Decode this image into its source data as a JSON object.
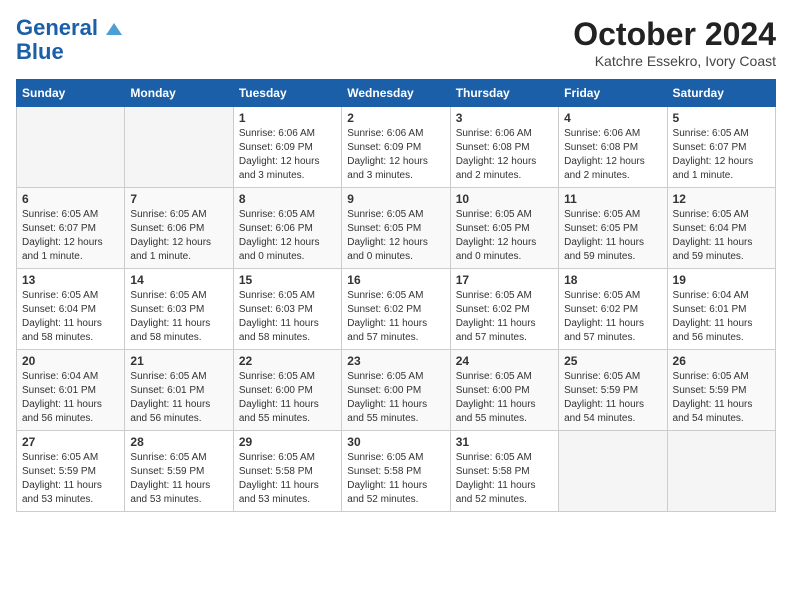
{
  "logo": {
    "line1": "General",
    "line2": "Blue"
  },
  "title": "October 2024",
  "subtitle": "Katchre Essekro, Ivory Coast",
  "weekdays": [
    "Sunday",
    "Monday",
    "Tuesday",
    "Wednesday",
    "Thursday",
    "Friday",
    "Saturday"
  ],
  "weeks": [
    [
      {
        "day": "",
        "info": ""
      },
      {
        "day": "",
        "info": ""
      },
      {
        "day": "1",
        "info": "Sunrise: 6:06 AM\nSunset: 6:09 PM\nDaylight: 12 hours\nand 3 minutes."
      },
      {
        "day": "2",
        "info": "Sunrise: 6:06 AM\nSunset: 6:09 PM\nDaylight: 12 hours\nand 3 minutes."
      },
      {
        "day": "3",
        "info": "Sunrise: 6:06 AM\nSunset: 6:08 PM\nDaylight: 12 hours\nand 2 minutes."
      },
      {
        "day": "4",
        "info": "Sunrise: 6:06 AM\nSunset: 6:08 PM\nDaylight: 12 hours\nand 2 minutes."
      },
      {
        "day": "5",
        "info": "Sunrise: 6:05 AM\nSunset: 6:07 PM\nDaylight: 12 hours\nand 1 minute."
      }
    ],
    [
      {
        "day": "6",
        "info": "Sunrise: 6:05 AM\nSunset: 6:07 PM\nDaylight: 12 hours\nand 1 minute."
      },
      {
        "day": "7",
        "info": "Sunrise: 6:05 AM\nSunset: 6:06 PM\nDaylight: 12 hours\nand 1 minute."
      },
      {
        "day": "8",
        "info": "Sunrise: 6:05 AM\nSunset: 6:06 PM\nDaylight: 12 hours\nand 0 minutes."
      },
      {
        "day": "9",
        "info": "Sunrise: 6:05 AM\nSunset: 6:05 PM\nDaylight: 12 hours\nand 0 minutes."
      },
      {
        "day": "10",
        "info": "Sunrise: 6:05 AM\nSunset: 6:05 PM\nDaylight: 12 hours\nand 0 minutes."
      },
      {
        "day": "11",
        "info": "Sunrise: 6:05 AM\nSunset: 6:05 PM\nDaylight: 11 hours\nand 59 minutes."
      },
      {
        "day": "12",
        "info": "Sunrise: 6:05 AM\nSunset: 6:04 PM\nDaylight: 11 hours\nand 59 minutes."
      }
    ],
    [
      {
        "day": "13",
        "info": "Sunrise: 6:05 AM\nSunset: 6:04 PM\nDaylight: 11 hours\nand 58 minutes."
      },
      {
        "day": "14",
        "info": "Sunrise: 6:05 AM\nSunset: 6:03 PM\nDaylight: 11 hours\nand 58 minutes."
      },
      {
        "day": "15",
        "info": "Sunrise: 6:05 AM\nSunset: 6:03 PM\nDaylight: 11 hours\nand 58 minutes."
      },
      {
        "day": "16",
        "info": "Sunrise: 6:05 AM\nSunset: 6:02 PM\nDaylight: 11 hours\nand 57 minutes."
      },
      {
        "day": "17",
        "info": "Sunrise: 6:05 AM\nSunset: 6:02 PM\nDaylight: 11 hours\nand 57 minutes."
      },
      {
        "day": "18",
        "info": "Sunrise: 6:05 AM\nSunset: 6:02 PM\nDaylight: 11 hours\nand 57 minutes."
      },
      {
        "day": "19",
        "info": "Sunrise: 6:04 AM\nSunset: 6:01 PM\nDaylight: 11 hours\nand 56 minutes."
      }
    ],
    [
      {
        "day": "20",
        "info": "Sunrise: 6:04 AM\nSunset: 6:01 PM\nDaylight: 11 hours\nand 56 minutes."
      },
      {
        "day": "21",
        "info": "Sunrise: 6:05 AM\nSunset: 6:01 PM\nDaylight: 11 hours\nand 56 minutes."
      },
      {
        "day": "22",
        "info": "Sunrise: 6:05 AM\nSunset: 6:00 PM\nDaylight: 11 hours\nand 55 minutes."
      },
      {
        "day": "23",
        "info": "Sunrise: 6:05 AM\nSunset: 6:00 PM\nDaylight: 11 hours\nand 55 minutes."
      },
      {
        "day": "24",
        "info": "Sunrise: 6:05 AM\nSunset: 6:00 PM\nDaylight: 11 hours\nand 55 minutes."
      },
      {
        "day": "25",
        "info": "Sunrise: 6:05 AM\nSunset: 5:59 PM\nDaylight: 11 hours\nand 54 minutes."
      },
      {
        "day": "26",
        "info": "Sunrise: 6:05 AM\nSunset: 5:59 PM\nDaylight: 11 hours\nand 54 minutes."
      }
    ],
    [
      {
        "day": "27",
        "info": "Sunrise: 6:05 AM\nSunset: 5:59 PM\nDaylight: 11 hours\nand 53 minutes."
      },
      {
        "day": "28",
        "info": "Sunrise: 6:05 AM\nSunset: 5:59 PM\nDaylight: 11 hours\nand 53 minutes."
      },
      {
        "day": "29",
        "info": "Sunrise: 6:05 AM\nSunset: 5:58 PM\nDaylight: 11 hours\nand 53 minutes."
      },
      {
        "day": "30",
        "info": "Sunrise: 6:05 AM\nSunset: 5:58 PM\nDaylight: 11 hours\nand 52 minutes."
      },
      {
        "day": "31",
        "info": "Sunrise: 6:05 AM\nSunset: 5:58 PM\nDaylight: 11 hours\nand 52 minutes."
      },
      {
        "day": "",
        "info": ""
      },
      {
        "day": "",
        "info": ""
      }
    ]
  ]
}
